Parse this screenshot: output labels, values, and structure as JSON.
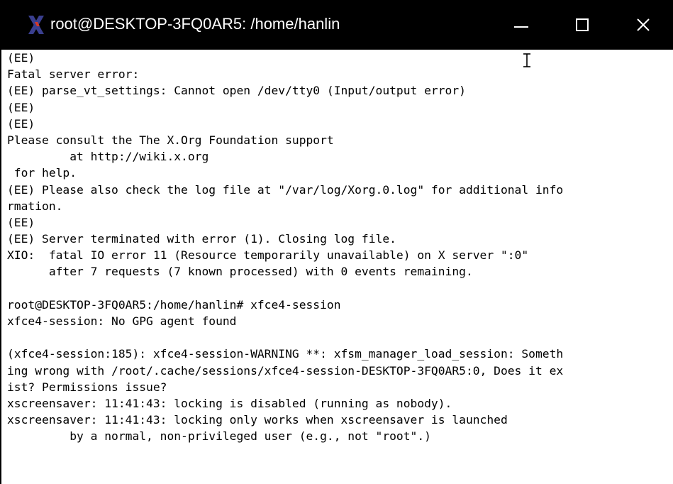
{
  "window": {
    "title": "root@DESKTOP-3FQ0AR5: /home/hanlin",
    "app_icon": "x-icon",
    "controls": {
      "minimize_icon": "minimize-icon",
      "maximize_icon": "maximize-icon",
      "close_icon": "close-icon",
      "close_glyph": "✕"
    },
    "colors": {
      "titlebar": "#000000",
      "title_text": "#ffffff",
      "terminal_bg": "#ffffff",
      "terminal_text": "#000000",
      "icon_x_primary": "#3a3f8f",
      "icon_x_accent": "#d43a2a"
    }
  },
  "terminal": {
    "lines": [
      "(EE)",
      "Fatal server error:",
      "(EE) parse_vt_settings: Cannot open /dev/tty0 (Input/output error)",
      "(EE)",
      "(EE)",
      "Please consult the The X.Org Foundation support",
      "         at http://wiki.x.org",
      " for help.",
      "(EE) Please also check the log file at \"/var/log/Xorg.0.log\" for additional info",
      "rmation.",
      "(EE)",
      "(EE) Server terminated with error (1). Closing log file.",
      "XIO:  fatal IO error 11 (Resource temporarily unavailable) on X server \":0\"",
      "      after 7 requests (7 known processed) with 0 events remaining.",
      "",
      "root@DESKTOP-3FQ0AR5:/home/hanlin# xfce4-session",
      "xfce4-session: No GPG agent found",
      "",
      "(xfce4-session:185): xfce4-session-WARNING **: xfsm_manager_load_session: Someth",
      "ing wrong with /root/.cache/sessions/xfce4-session-DESKTOP-3FQ0AR5:0, Does it ex",
      "ist? Permissions issue?",
      "xscreensaver: 11:41:43: locking is disabled (running as nobody).",
      "xscreensaver: 11:41:43: locking only works when xscreensaver is launched",
      "         by a normal, non-privileged user (e.g., not \"root\".)"
    ]
  }
}
